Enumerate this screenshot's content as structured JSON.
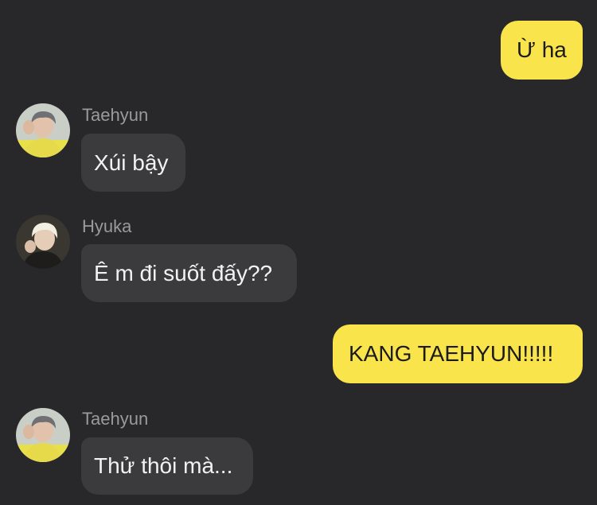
{
  "messages": [
    {
      "direction": "out",
      "text": "Ừ ha"
    },
    {
      "direction": "in",
      "sender": "Taehyun",
      "avatar_icon": "taehyun-avatar",
      "text": "Xúi bậy"
    },
    {
      "direction": "in",
      "sender": "Hyuka",
      "avatar_icon": "hyuka-avatar",
      "text": "Ê m đi suốt đấy??"
    },
    {
      "direction": "out",
      "text": "KANG TAEHYUN!!!!!"
    },
    {
      "direction": "in",
      "sender": "Taehyun",
      "avatar_icon": "taehyun-avatar",
      "text": "Thử thôi mà..."
    }
  ],
  "colors": {
    "background": "#28282a",
    "outgoing_bubble": "#fae44b",
    "incoming_bubble": "#3b3b3e",
    "sender_name": "#9a9a9c"
  }
}
